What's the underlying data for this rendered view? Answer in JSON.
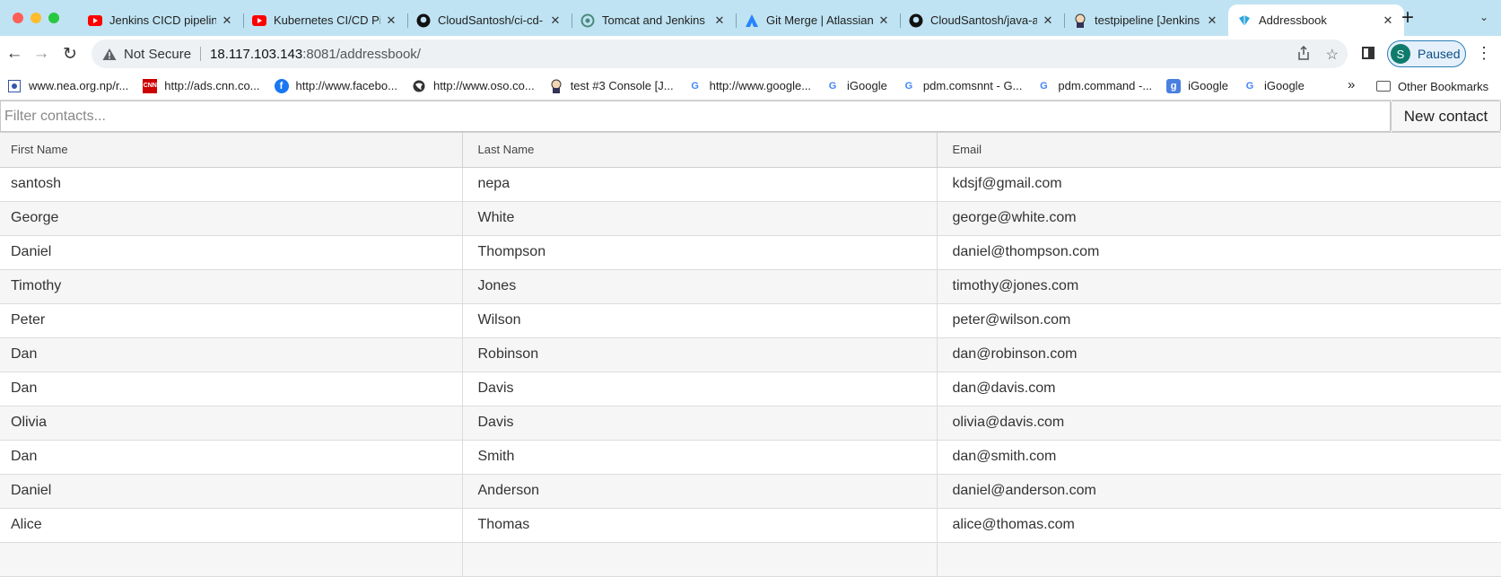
{
  "browser": {
    "tabs": [
      {
        "title": "Jenkins CICD pipeline",
        "icon": "youtube-icon"
      },
      {
        "title": "Kubernetes CI/CD Pipeline",
        "icon": "youtube-icon"
      },
      {
        "title": "CloudSantosh/ci-cd-",
        "icon": "github-icon"
      },
      {
        "title": "Tomcat and Jenkins",
        "icon": "openai-icon"
      },
      {
        "title": "Git Merge | Atlassian",
        "icon": "atlassian-icon"
      },
      {
        "title": "CloudSantosh/java-a",
        "icon": "github-icon"
      },
      {
        "title": "testpipeline [Jenkins",
        "icon": "jenkins-icon"
      },
      {
        "title": "Addressbook",
        "icon": "addressbook-icon",
        "active": true
      }
    ],
    "address": {
      "security_label": "Not Secure",
      "host": "18.117.103.143",
      "path": ":8081/addressbook/"
    },
    "profile": {
      "initial": "S",
      "status": "Paused"
    },
    "bookmarks": [
      {
        "label": "www.nea.org.np/r...",
        "icon": "nea-icon"
      },
      {
        "label": "http://ads.cnn.co...",
        "icon": "cnn-icon"
      },
      {
        "label": "http://www.facebo...",
        "icon": "facebook-icon"
      },
      {
        "label": "http://www.oso.co...",
        "icon": "globe-icon"
      },
      {
        "label": "test #3 Console [J...",
        "icon": "jenkins-icon"
      },
      {
        "label": "http://www.google...",
        "icon": "google-icon"
      },
      {
        "label": "iGoogle",
        "icon": "google-icon"
      },
      {
        "label": "pdm.comsnnt - G...",
        "icon": "google-icon"
      },
      {
        "label": "pdm.command -...",
        "icon": "google-icon"
      },
      {
        "label": "iGoogle",
        "icon": "igoogle-icon"
      },
      {
        "label": "iGoogle",
        "icon": "google-icon"
      }
    ],
    "other_bookmarks": "Other Bookmarks"
  },
  "app": {
    "filter_placeholder": "Filter contacts...",
    "new_contact_label": "New contact",
    "columns": [
      "First Name",
      "Last Name",
      "Email"
    ],
    "contacts": [
      {
        "first": "santosh",
        "last": "nepa",
        "email": "kdsjf@gmail.com"
      },
      {
        "first": "George",
        "last": "White",
        "email": "george@white.com"
      },
      {
        "first": "Daniel",
        "last": "Thompson",
        "email": "daniel@thompson.com"
      },
      {
        "first": "Timothy",
        "last": "Jones",
        "email": "timothy@jones.com"
      },
      {
        "first": "Peter",
        "last": "Wilson",
        "email": "peter@wilson.com"
      },
      {
        "first": "Dan",
        "last": "Robinson",
        "email": "dan@robinson.com"
      },
      {
        "first": "Dan",
        "last": "Davis",
        "email": "dan@davis.com"
      },
      {
        "first": "Olivia",
        "last": "Davis",
        "email": "olivia@davis.com"
      },
      {
        "first": "Dan",
        "last": "Smith",
        "email": "dan@smith.com"
      },
      {
        "first": "Daniel",
        "last": "Anderson",
        "email": "daniel@anderson.com"
      },
      {
        "first": "Alice",
        "last": "Thomas",
        "email": "alice@thomas.com"
      },
      {
        "first": "",
        "last": "",
        "email": ""
      }
    ]
  },
  "colors": {
    "tabstrip": "#bfe3f3",
    "youtube": "#ff0000",
    "facebook": "#1877f2",
    "atlassian": "#2684ff"
  }
}
